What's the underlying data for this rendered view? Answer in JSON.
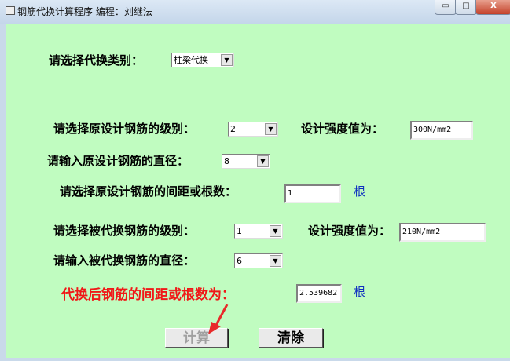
{
  "window": {
    "title": "钢筋代换计算程序 编程：刘继法",
    "minimize": "▭",
    "maximize": "□",
    "close": "X"
  },
  "form": {
    "category_label": "请选择代换类别：",
    "category_value": "柱梁代换",
    "orig_grade_label": "请选择原设计钢筋的级别：",
    "orig_grade_value": "2",
    "orig_strength_label": "设计强度值为：",
    "orig_strength_value": "300N/mm2",
    "orig_diameter_label": "请输入原设计钢筋的直径：",
    "orig_diameter_value": "8",
    "orig_spacing_label": "请选择原设计钢筋的间距或根数：",
    "orig_spacing_value": "1",
    "orig_spacing_unit": "根",
    "new_grade_label": "请选择被代换钢筋的级别：",
    "new_grade_value": "1",
    "new_strength_label": "设计强度值为：",
    "new_strength_value": "210N/mm2",
    "new_diameter_label": "请输入被代换钢筋的直径：",
    "new_diameter_value": "6",
    "result_label": "代换后钢筋的间距或根数为：",
    "result_value": "2.539682",
    "result_unit": "根"
  },
  "buttons": {
    "calculate": "计算",
    "clear": "清除"
  },
  "dropdown_arrow": "▼"
}
